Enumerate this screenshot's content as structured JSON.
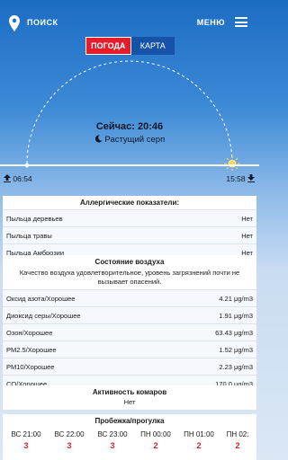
{
  "header": {
    "search_label": "ПОИСК",
    "menu_label": "МЕНЮ"
  },
  "tabs": [
    {
      "label": "Погода",
      "active": true
    },
    {
      "label": "Карта",
      "active": false
    }
  ],
  "sky": {
    "now": "Сейчас: 20:46",
    "moon_phase": "Растущий серп",
    "sunrise": "06:54",
    "sunset": "15:58"
  },
  "allergy": {
    "title": "Аллергические показатели:",
    "rows": [
      {
        "label": "Пыльца деревьев",
        "value": "Нет"
      },
      {
        "label": "Пыльца травы",
        "value": "Нет"
      },
      {
        "label": "Пыльца Амброзии",
        "value": "Нет"
      }
    ]
  },
  "air": {
    "title": "Состояние воздуха",
    "note": "Качество воздуха удовлетворительное, уровень загрязнений почти не вызывает опасений.",
    "rows": [
      {
        "label": "Оксид азота/Хорошее",
        "value": "4.21 μg/m3"
      },
      {
        "label": "Диоксид серы/Хорошее",
        "value": "1.91 μg/m3"
      },
      {
        "label": "Озон/Хорошее",
        "value": "63.43 μg/m3"
      },
      {
        "label": "PM2.5/Хорошее",
        "value": "1.52 μg/m3"
      },
      {
        "label": "PM10/Хорошее",
        "value": "2.23 μg/m3"
      },
      {
        "label": "CO/Хорошее",
        "value": "170.0 μg/m3"
      }
    ]
  },
  "mosquito": {
    "title": "Активность комаров",
    "value": "Нет"
  },
  "running": {
    "title": "Пробежка/прогулка",
    "hours": [
      {
        "time": "ВС 21:00",
        "score": "3"
      },
      {
        "time": "ВС 22:00",
        "score": "3"
      },
      {
        "time": "ВС 23:00",
        "score": "3"
      },
      {
        "time": "ПН 00:00",
        "score": "2"
      },
      {
        "time": "ПН 01:00",
        "score": "2"
      },
      {
        "time": "ПН 02:",
        "score": "2"
      }
    ]
  },
  "colors": {
    "accent": "#e41d2a",
    "tab_inactive": "#1653a8",
    "sky_top": "#1b6cc4"
  }
}
